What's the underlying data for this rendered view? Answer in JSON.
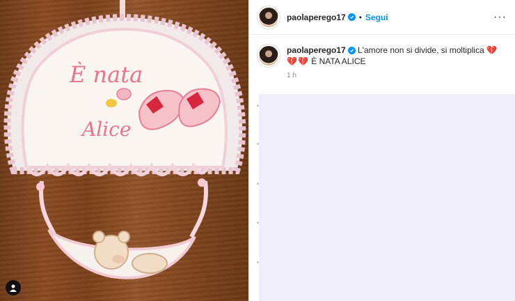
{
  "post": {
    "username": "paolaperego17",
    "follow_label": "Segui",
    "separator": "•",
    "more_icon": "···",
    "caption": {
      "username": "paolaperego17",
      "text": "L'amore non si divide, si moltiplica",
      "hearts": "💔💔💔",
      "text_end": "È NATA ALICE"
    },
    "timestamp": "1 h"
  },
  "photo": {
    "embroidery_line1": "È nata",
    "embroidery_line2": "Alice"
  },
  "colors": {
    "accent": "#0095f6",
    "wood": "#8a4b22",
    "comments_bg": "#efeef9"
  }
}
